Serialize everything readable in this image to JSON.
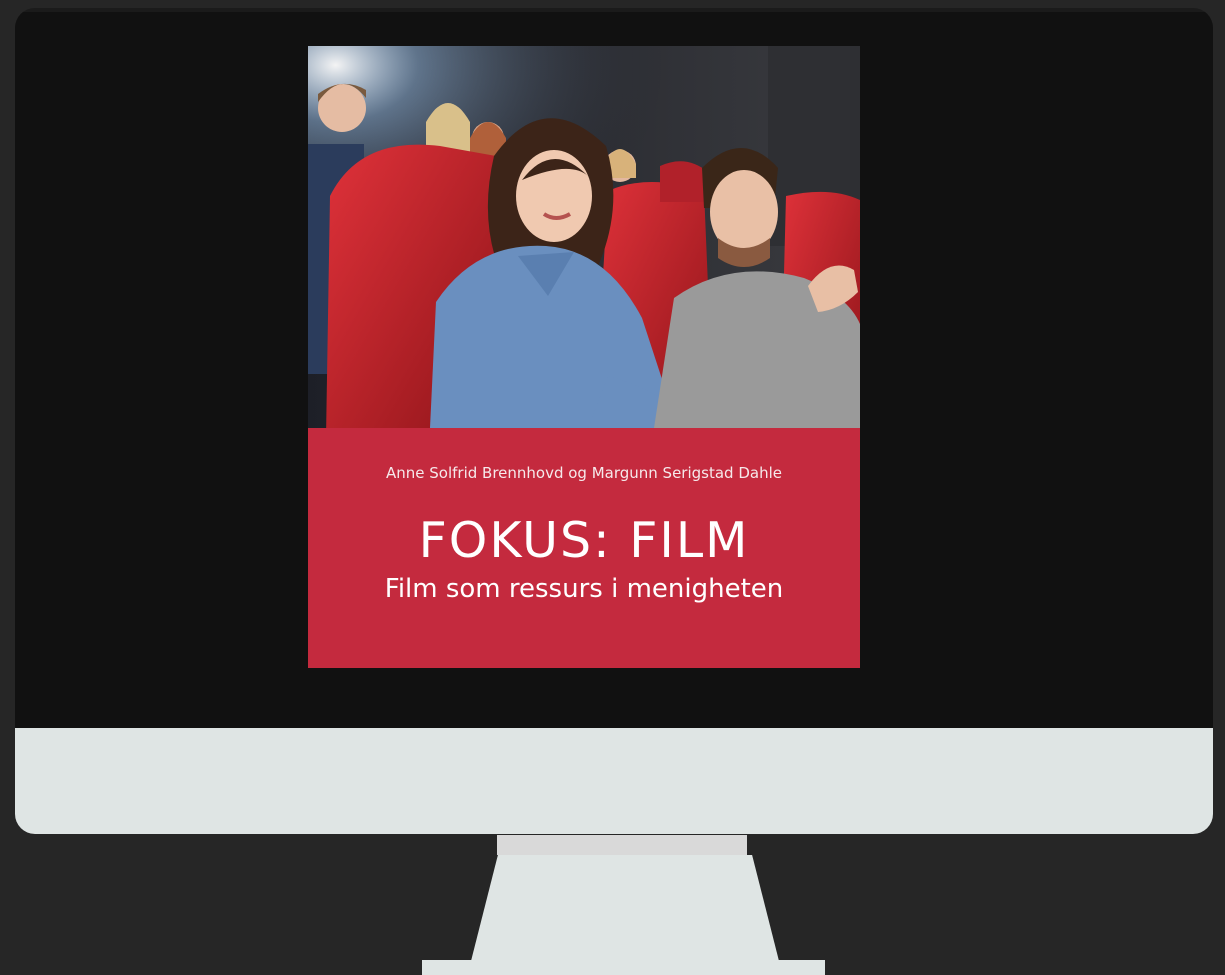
{
  "colors": {
    "page_background": "#262626",
    "screen": "#111111",
    "monitor_body": "#dfe5e4",
    "cover_red": "#c42a3e",
    "seat_red": "#c8232b",
    "denim": "#6a8fbf",
    "sweater": "#9a9a9a"
  },
  "book": {
    "authors": "Anne Solfrid Brennhovd og Margunn Serigstad Dahle",
    "title": "FOKUS: FILM",
    "subtitle": "Film som ressurs i menigheten"
  },
  "photo": {
    "subject": "audience-in-cinema"
  }
}
